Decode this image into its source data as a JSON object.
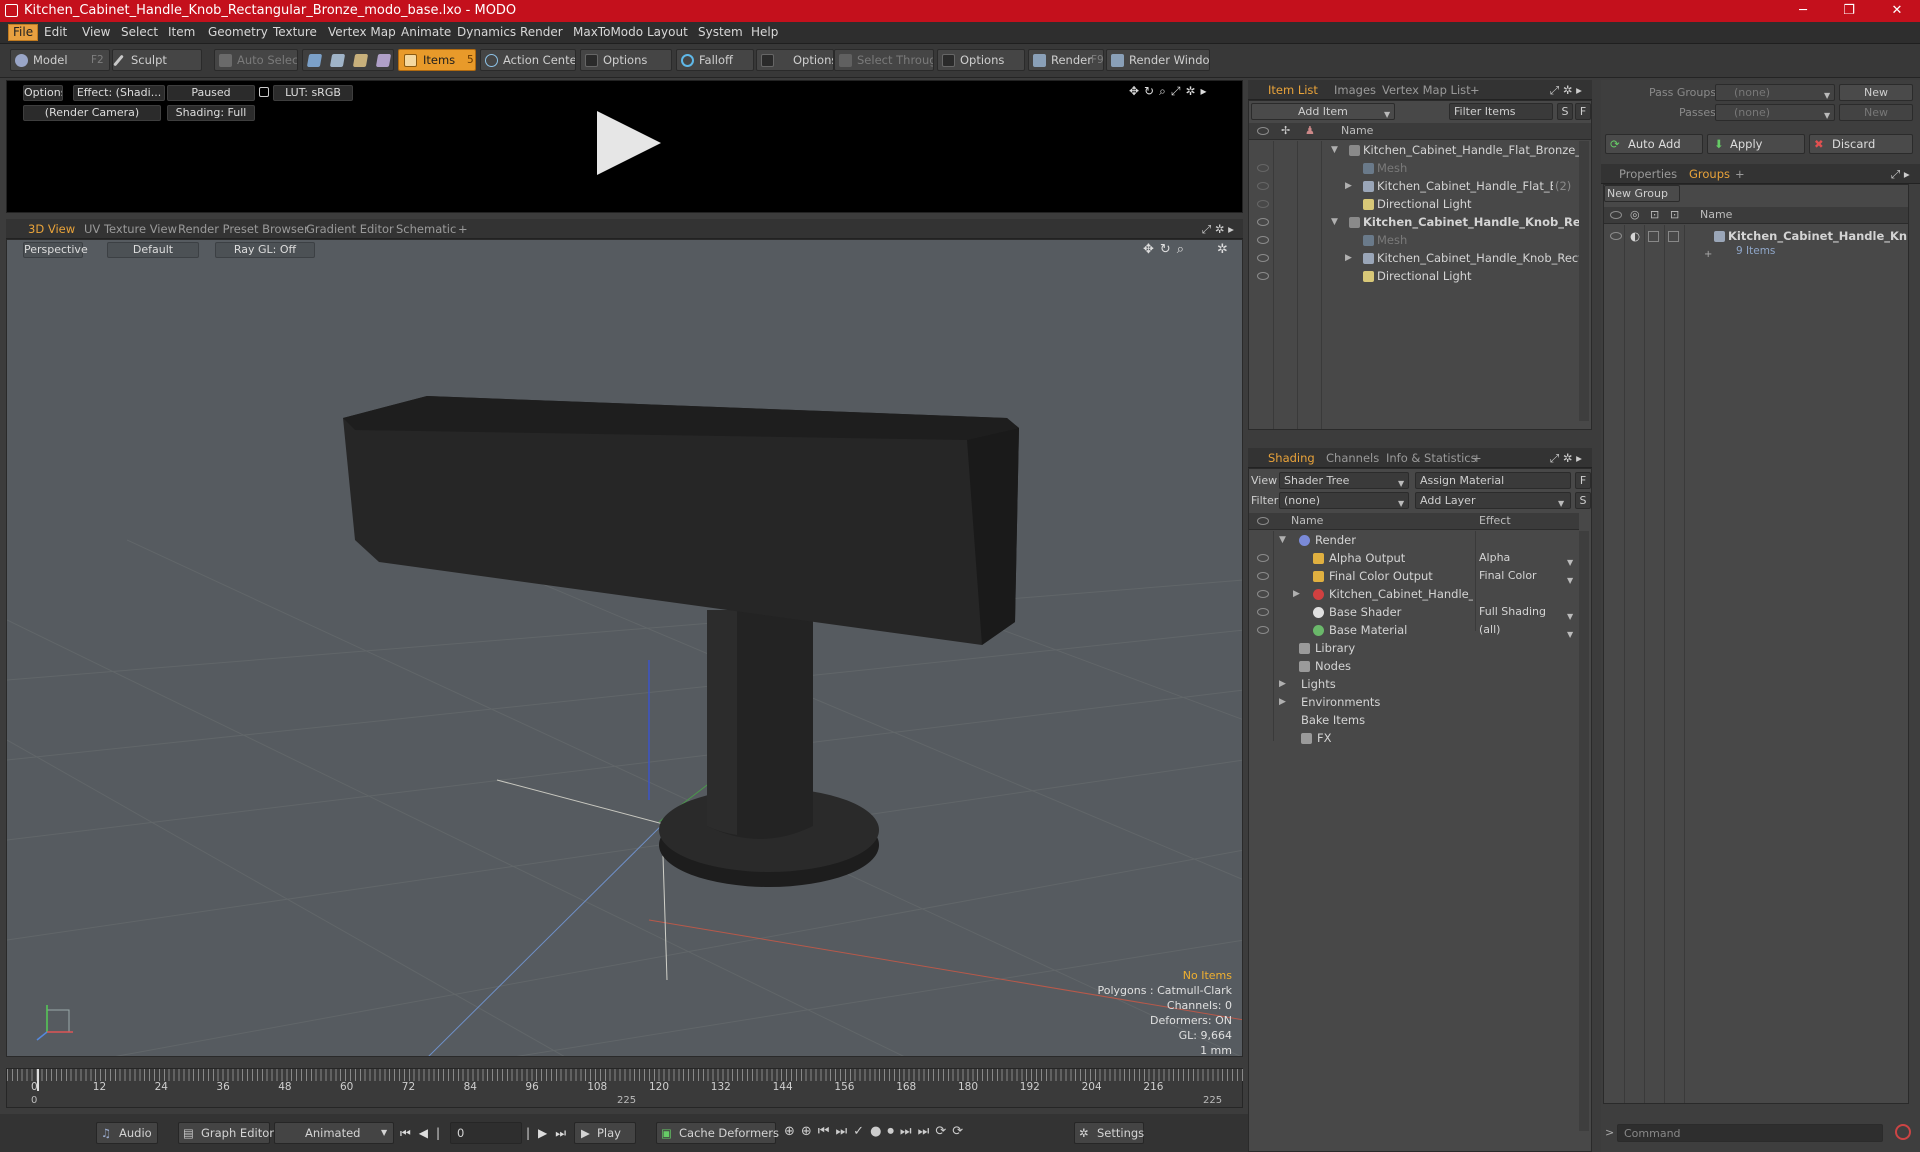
{
  "window": {
    "title": "Kitchen_Cabinet_Handle_Knob_Rectangular_Bronze_modo_base.lxo - MODO",
    "minimize": "─",
    "maximize": "❐",
    "close": "✕"
  },
  "menu": [
    "File",
    "Edit",
    "View",
    "Select",
    "Item",
    "Geometry",
    "Texture",
    "Vertex Map",
    "Animate",
    "Dynamics",
    "Render",
    "MaxToModo",
    "Layout",
    "System",
    "Help"
  ],
  "toolbar": {
    "model": "Model",
    "model_key": "F2",
    "sculpt": "Sculpt",
    "auto_select": "Auto Select",
    "items": "Items",
    "items_key": "5",
    "action_center": "Action Center",
    "options1": "Options",
    "falloff": "Falloff",
    "options2": "Options",
    "select_through": "Select Through",
    "options3": "Options",
    "render": "Render",
    "render_key": "F9",
    "render_window": "Render Window"
  },
  "preview": {
    "options": "Options",
    "effect": "Effect: (Shadi...",
    "paused": "Paused",
    "lut": "LUT: sRGB",
    "camera": "(Render Camera)",
    "shading": "Shading: Full"
  },
  "viewport_tabs": [
    "3D View",
    "UV Texture View",
    "Render Preset Browser",
    "Gradient Editor",
    "Schematic",
    "+"
  ],
  "viewport": {
    "perspective": "Perspective",
    "default": "Default",
    "raygl": "Ray GL: Off",
    "stats": {
      "no_items": "No Items",
      "polygons": "Polygons : Catmull-Clark",
      "channels": "Channels: 0",
      "deformers": "Deformers: ON",
      "gl": "GL: 9,664",
      "unit": "1 mm"
    }
  },
  "timeline": {
    "ticks": [
      "0",
      "12",
      "24",
      "36",
      "48",
      "60",
      "72",
      "84",
      "96",
      "108",
      "120",
      "132",
      "144",
      "156",
      "168",
      "180",
      "192",
      "204",
      "216"
    ],
    "start": "0",
    "mid": "225",
    "end": "225"
  },
  "bottom": {
    "audio": "Audio",
    "graph_editor": "Graph Editor",
    "animated": "Animated",
    "frame": "0",
    "play": "Play",
    "cache_deformers": "Cache Deformers",
    "settings": "Settings"
  },
  "item_list": {
    "tabs": [
      "Item List",
      "Images",
      "Vertex Map List",
      "+"
    ],
    "add_item": "Add Item",
    "filter_items": "Filter Items",
    "s": "S",
    "f": "F",
    "name_header": "Name",
    "rows": [
      {
        "label": "Kitchen_Cabinet_Handle_Flat_Bronze_m ...",
        "expanded": true
      },
      {
        "label": "Mesh"
      },
      {
        "label": "Kitchen_Cabinet_Handle_Flat_Bronze",
        "suffix": "(2)"
      },
      {
        "label": "Directional Light"
      },
      {
        "label": "Kitchen_Cabinet_Handle_Knob_Re ...",
        "expanded": true
      },
      {
        "label": "Mesh"
      },
      {
        "label": "Kitchen_Cabinet_Handle_Knob_Recta ..."
      },
      {
        "label": "Directional Light"
      }
    ]
  },
  "shading": {
    "tabs": [
      "Shading",
      "Channels",
      "Info & Statistics",
      "+"
    ],
    "view_label": "View",
    "view_value": "Shader Tree",
    "assign_material": "Assign Material",
    "f": "F",
    "filter_label": "Filter",
    "filter_value": "(none)",
    "add_layer": "Add Layer",
    "s": "S",
    "name_header": "Name",
    "effect_header": "Effect",
    "rows": [
      {
        "label": "Render",
        "effect": ""
      },
      {
        "label": "Alpha Output",
        "effect": "Alpha"
      },
      {
        "label": "Final Color Output",
        "effect": "Final Color"
      },
      {
        "label": "Kitchen_Cabinet_Handle_K...",
        "effect": ""
      },
      {
        "label": "Base Shader",
        "effect": "Full Shading"
      },
      {
        "label": "Base Material",
        "effect": "(all)"
      },
      {
        "label": "Library",
        "effect": ""
      },
      {
        "label": "Nodes",
        "effect": ""
      },
      {
        "label": "Lights",
        "effect": ""
      },
      {
        "label": "Environments",
        "effect": ""
      },
      {
        "label": "Bake Items",
        "effect": ""
      },
      {
        "label": "FX",
        "effect": ""
      }
    ]
  },
  "groups": {
    "pass_groups_label": "Pass Groups",
    "pass_groups_value": "(none)",
    "new1": "New",
    "passes_label": "Passes",
    "passes_value": "(none)",
    "new2": "New",
    "auto_add": "Auto Add",
    "apply": "Apply",
    "discard": "Discard",
    "tabs": [
      "Properties",
      "Groups",
      "+"
    ],
    "new_group": "New Group",
    "name_header": "Name",
    "item_name": "Kitchen_Cabinet_Handle_Kn ...",
    "item_count": "9 Items",
    "command_placeholder": "Command"
  },
  "colors": {
    "title_red": "#c4101c",
    "accent_orange": "#e89a2a",
    "viewport_bg": "#565b60"
  }
}
